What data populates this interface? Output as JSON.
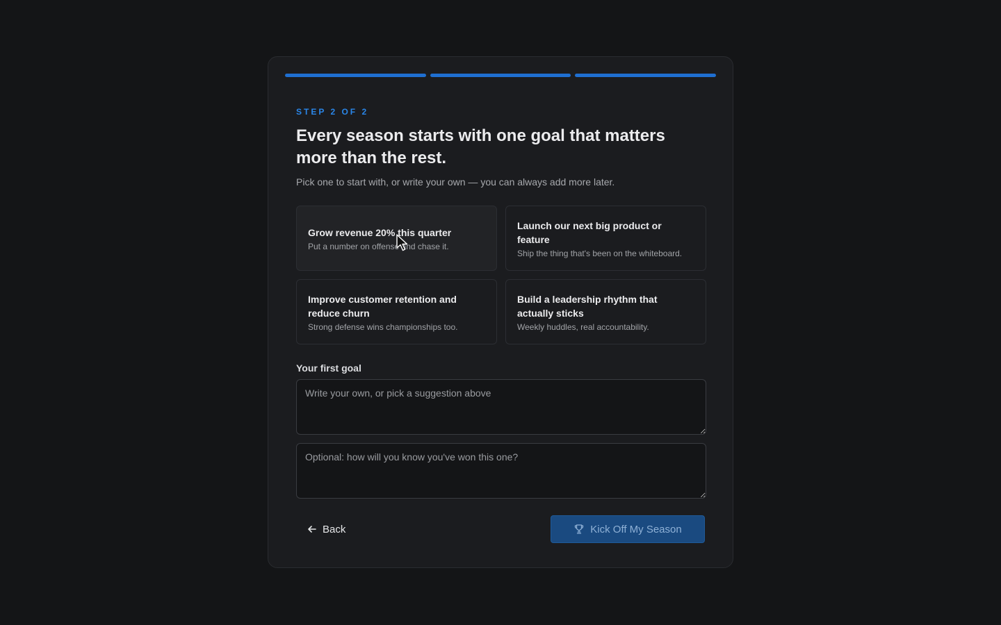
{
  "progress": {
    "steps_total": 3,
    "steps_filled": 3,
    "fill_color": "#1f6fd1"
  },
  "header": {
    "step_label": "STEP 2 OF 2",
    "title": "Every season starts with one goal that matters more than the rest.",
    "subtitle": "Pick one to start with, or write your own — you can always add more later."
  },
  "suggestions": [
    {
      "title": "Grow revenue 20% this quarter",
      "desc": "Put a number on offense and chase it."
    },
    {
      "title": "Launch our next big product or feature",
      "desc": "Ship the thing that's been on the whiteboard."
    },
    {
      "title": "Improve customer retention and reduce churn",
      "desc": "Strong defense wins championships too."
    },
    {
      "title": "Build a leadership rhythm that actually sticks",
      "desc": "Weekly huddles, real accountability."
    }
  ],
  "form": {
    "goal_label": "Your first goal",
    "goal_placeholder": "Write your own, or pick a suggestion above",
    "goal_value": "",
    "success_placeholder": "Optional: how will you know you've won this one?",
    "success_value": ""
  },
  "actions": {
    "back_label": "Back",
    "back_icon": "arrow-left-icon",
    "submit_label": "Kick Off My Season",
    "submit_icon": "trophy-icon",
    "submit_enabled": false
  },
  "colors": {
    "accent": "#2a86e8",
    "background": "#141517",
    "card": "#1b1c1f"
  }
}
